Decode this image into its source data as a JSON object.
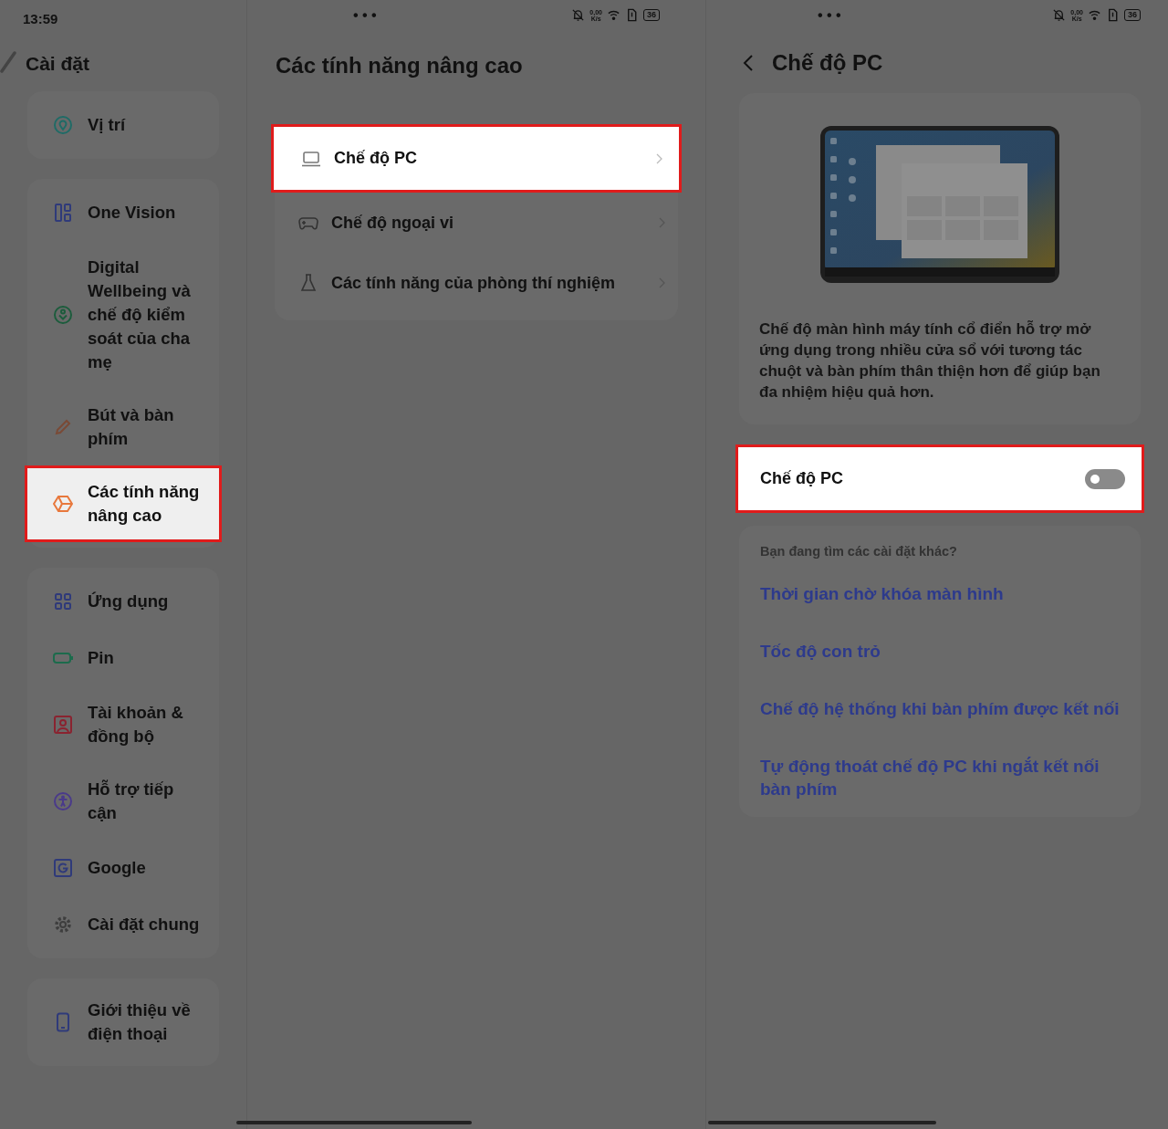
{
  "status_bar": {
    "time": "13:59",
    "panels": [
      {
        "more": "• • •",
        "speed_value": "0,00",
        "speed_unit": "K/s",
        "battery": "36"
      },
      {
        "more": "• • •",
        "speed_value": "0,00",
        "speed_unit": "K/s",
        "battery": "36"
      }
    ]
  },
  "sidebar": {
    "title": "Cài đặt",
    "groups": [
      {
        "items": [
          {
            "label": "Vị trí",
            "kind": "location",
            "highlighted": false
          }
        ]
      },
      {
        "items": [
          {
            "label": "One Vision",
            "kind": "vision",
            "highlighted": false
          },
          {
            "label": "Digital Wellbeing và chế độ kiểm soát của cha mẹ",
            "kind": "wellbeing",
            "highlighted": false
          },
          {
            "label": "Bút và bàn phím",
            "kind": "pen",
            "highlighted": false
          },
          {
            "label": "Các tính năng nâng cao",
            "kind": "cube",
            "highlighted": true
          }
        ]
      },
      {
        "items": [
          {
            "label": "Ứng dụng",
            "kind": "apps",
            "highlighted": false
          },
          {
            "label": "Pin",
            "kind": "battery",
            "highlighted": false
          },
          {
            "label": "Tài khoản & đồng bộ",
            "kind": "account",
            "highlighted": false
          },
          {
            "label": "Hỗ trợ tiếp cận",
            "kind": "accessibility",
            "highlighted": false
          },
          {
            "label": "Google",
            "kind": "google",
            "highlighted": false
          },
          {
            "label": "Cài đặt chung",
            "kind": "gear",
            "highlighted": false
          }
        ]
      },
      {
        "items": [
          {
            "label": "Giới thiệu về điện thoại",
            "kind": "phone",
            "highlighted": false
          }
        ]
      }
    ]
  },
  "advanced": {
    "title": "Các tính năng nâng cao",
    "rows": [
      {
        "label": "Chế độ PC",
        "kind": "laptop",
        "highlighted": true
      },
      {
        "label": "Chế độ ngoại vi",
        "kind": "gamepad",
        "highlighted": false
      },
      {
        "label": "Các tính năng của phòng thí nghiệm",
        "kind": "flask",
        "highlighted": false
      }
    ]
  },
  "pc_mode": {
    "title": "Chế độ PC",
    "description": "Chế độ màn hình máy tính cổ điển hỗ trợ mở ứng dụng trong nhiều cửa sổ với tương tác chuột và bàn phím thân thiện hơn để giúp bạn đa nhiệm hiệu quả hơn.",
    "toggle": {
      "label": "Chế độ PC",
      "on": false,
      "highlighted": true
    },
    "related": {
      "heading": "Bạn đang tìm các cài đặt khác?",
      "links": [
        "Thời gian chờ khóa màn hình",
        "Tốc độ con trỏ",
        "Chế độ hệ thống khi bàn phím được kết nối",
        "Tự động thoát chế độ PC khi ngắt kết nối bàn phím"
      ]
    }
  }
}
